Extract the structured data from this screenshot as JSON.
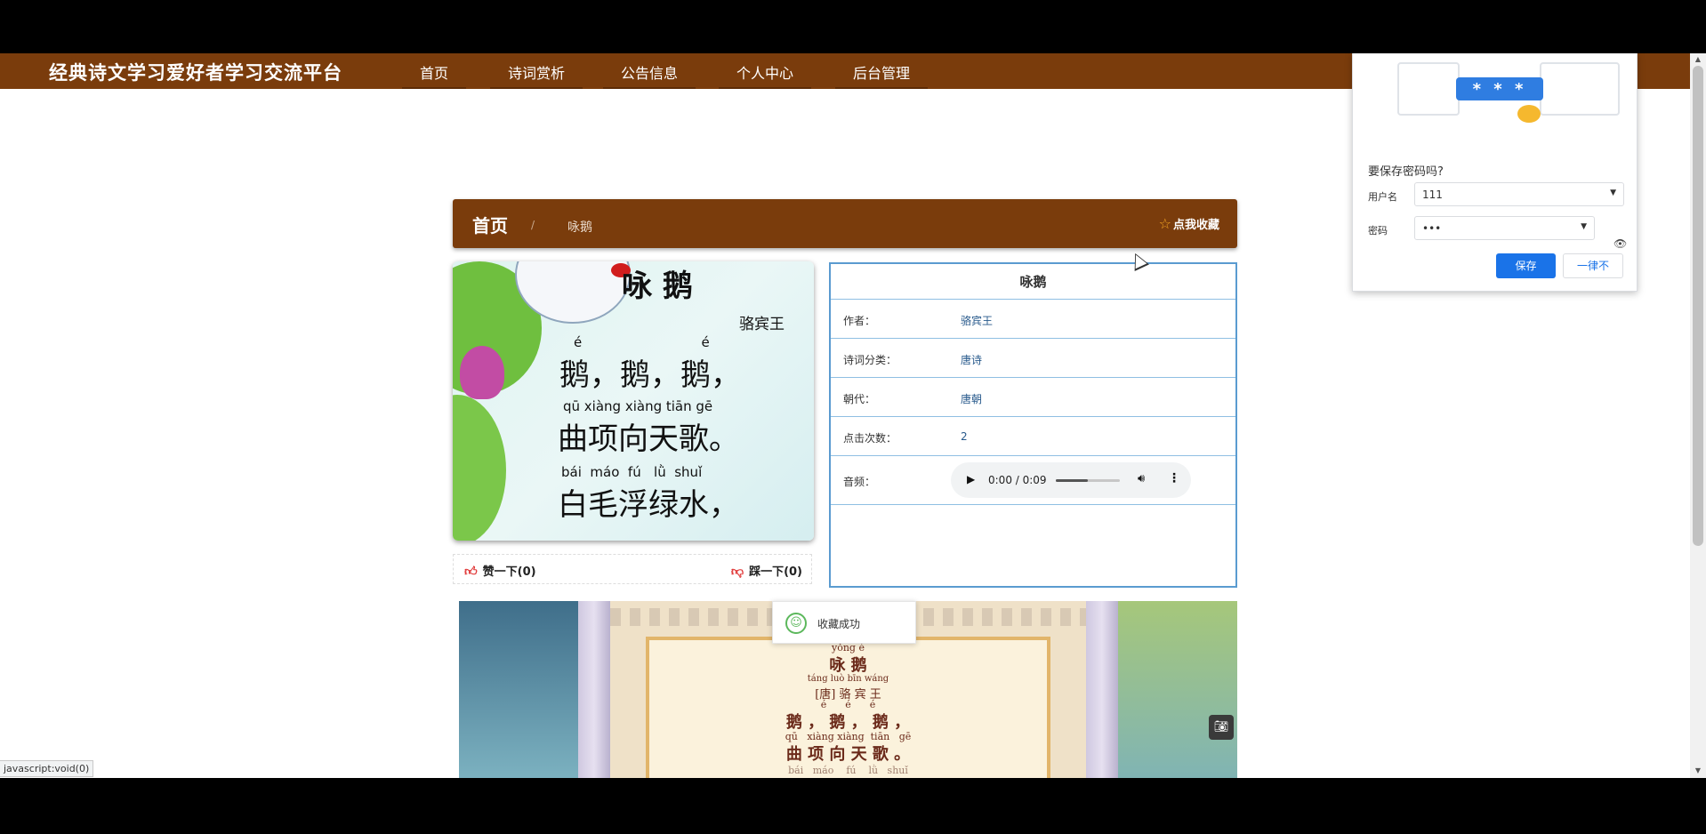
{
  "site": {
    "title": "经典诗文学习爱好者学习交流平台",
    "nav": [
      "首页",
      "诗词赏析",
      "公告信息",
      "个人中心",
      "后台管理"
    ]
  },
  "breadcrumb": {
    "home": "首页",
    "separator": "/",
    "current": "咏鹅",
    "collect_label": "点我收藏"
  },
  "poem_image": {
    "title": "咏 鹅",
    "author": "骆宾王",
    "lines": [
      {
        "pinyin": "é   é   é",
        "text": "鹅，鹅，鹅，"
      },
      {
        "pinyin": "qū xiàng xiàng tiān gē",
        "text": "曲项向天歌。"
      },
      {
        "pinyin": "bái  máo  fú   lǜ  shuǐ",
        "text": "白毛浮绿水，"
      }
    ]
  },
  "reactions": {
    "like_label": "赞一下(0)",
    "dislike_label": "踩一下(0)"
  },
  "info": {
    "title": "咏鹅",
    "rows": [
      {
        "key": "作者：",
        "value": "骆宾王"
      },
      {
        "key": "诗词分类：",
        "value": "唐诗"
      },
      {
        "key": "朝代：",
        "value": "唐朝"
      },
      {
        "key": "点击次数：",
        "value": "2"
      }
    ],
    "audio_label": "音频：",
    "audio_time": "0:00 / 0:09",
    "audio_volume_level": 0.5
  },
  "video": {
    "title_pinyin": "yǒng  é",
    "title": "咏  鹅",
    "author_pinyin": "táng  luò bīn wáng",
    "author": "[唐] 骆 宾 王",
    "line1_pinyin": "é      é      é",
    "line1": "鹅 ， 鹅 ， 鹅 ，",
    "line2_pinyin": "qū   xiàng xiàng  tiān   gē",
    "line2": "曲  项  向  天  歌 。",
    "line3_pinyin": "bái   máo    fú    lǜ   shuǐ"
  },
  "toast": {
    "message": "收藏成功"
  },
  "password_prompt": {
    "question": "要保存密码吗?",
    "username_label": "用户名",
    "username_value": "111",
    "password_label": "密码",
    "password_value": "•••",
    "save_label": "保存",
    "never_label": "一律不",
    "masked": "* * *"
  },
  "status_bar": "javascript:void(0)",
  "colors": {
    "brand": "#7a3c0c",
    "accent": "#1a73e8",
    "info_border": "#5a9bd0"
  }
}
